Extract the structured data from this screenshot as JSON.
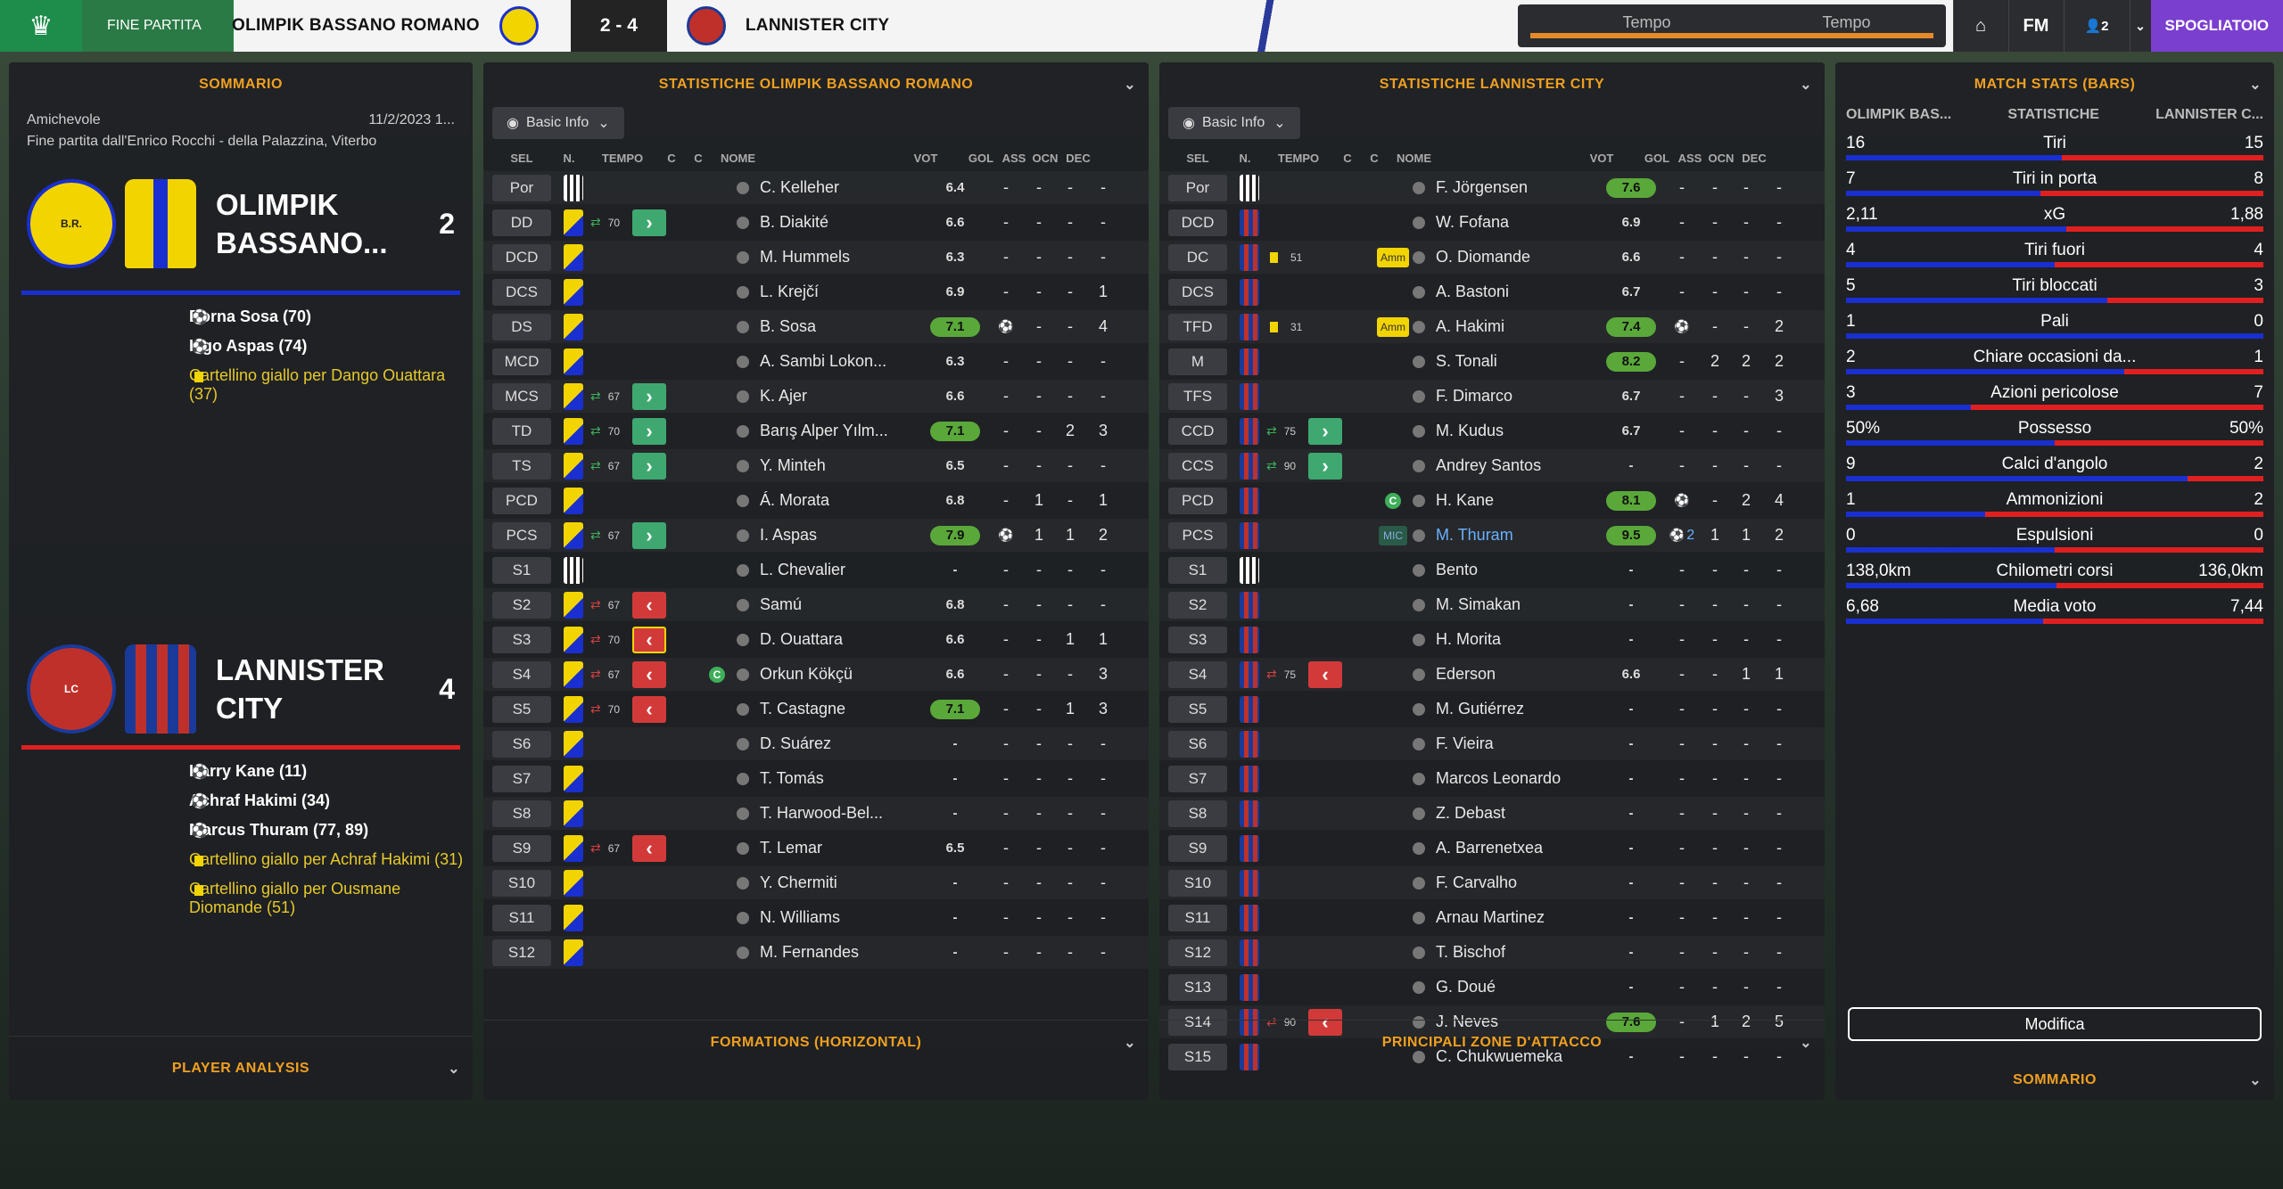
{
  "topbar": {
    "status": "FINE PARTITA",
    "home_team": "OLIMPIK BASSANO ROMANO",
    "score": "2 - 4",
    "away_team": "LANNISTER CITY",
    "time_label_1": "Tempo",
    "time_label_2": "Tempo",
    "fm": "FM",
    "people": "2",
    "spogliatoio": "SPOGLIATOIO"
  },
  "colors": {
    "home": "#1a2fd0",
    "away": "#e02020",
    "accent": "#f0a020"
  },
  "sommario": {
    "title": "SOMMARIO",
    "match_type": "Amichevole",
    "date": "11/2/2023 1...",
    "venue": "Fine partita dall'Enrico Rocchi - della Palazzina, Viterbo",
    "home_name": "OLIMPIK BASSANO...",
    "home_score": "2",
    "home_events": [
      {
        "type": "goal",
        "text": "Borna Sosa (70)"
      },
      {
        "type": "goal",
        "text": "Iago Aspas (74)"
      },
      {
        "type": "yellow",
        "text": "Cartellino giallo per Dango Ouattara (37)"
      }
    ],
    "away_name": "LANNISTER CITY",
    "away_score": "4",
    "away_events": [
      {
        "type": "goal",
        "text": "Harry Kane (11)"
      },
      {
        "type": "goal",
        "text": "Achraf Hakimi (34)"
      },
      {
        "type": "goal",
        "text": "Marcus Thuram (77, 89)"
      },
      {
        "type": "yellow",
        "text": "Cartellino giallo per Achraf Hakimi (31)"
      },
      {
        "type": "yellow",
        "text": "Cartellino giallo per Ousmane Diomande (51)"
      }
    ],
    "player_analysis": "PLAYER ANALYSIS"
  },
  "home_stats": {
    "title": "STATISTICHE OLIMPIK BASSANO ROMANO",
    "dropdown": "Basic Info",
    "headers": {
      "sel": "SEL",
      "n": "N.",
      "tempo": "TEMPO",
      "c1": "C",
      "c2": "C",
      "nome": "NOME",
      "vot": "VOT",
      "gol": "GOL",
      "ass": "ASS",
      "ocn": "OCN",
      "dec": "DEC"
    },
    "rows": [
      {
        "pos": "Por",
        "min": "",
        "sub": "",
        "c": "",
        "name": "C. Kelleher",
        "vot": "6.4",
        "g": false,
        "gol": "-",
        "ass": "-",
        "ocn": "-",
        "dec": "-",
        "goalicon": false
      },
      {
        "pos": "DD",
        "min": "70",
        "sub": "in",
        "c": "",
        "name": "B. Diakité",
        "vot": "6.6",
        "g": false,
        "gol": "-",
        "ass": "-",
        "ocn": "-",
        "dec": "-",
        "goalicon": false
      },
      {
        "pos": "DCD",
        "min": "",
        "sub": "",
        "c": "",
        "name": "M. Hummels",
        "vot": "6.3",
        "g": false,
        "gol": "-",
        "ass": "-",
        "ocn": "-",
        "dec": "-",
        "goalicon": false
      },
      {
        "pos": "DCS",
        "min": "",
        "sub": "",
        "c": "",
        "name": "L. Krejčí",
        "vot": "6.9",
        "g": false,
        "gol": "-",
        "ass": "-",
        "ocn": "-",
        "dec": "1",
        "goalicon": false
      },
      {
        "pos": "DS",
        "min": "",
        "sub": "",
        "c": "",
        "name": "B. Sosa",
        "vot": "7.1",
        "g": true,
        "gol": "",
        "ass": "-",
        "ocn": "-",
        "dec": "4",
        "goalicon": true
      },
      {
        "pos": "MCD",
        "min": "",
        "sub": "",
        "c": "",
        "name": "A. Sambi Lokon...",
        "vot": "6.3",
        "g": false,
        "gol": "-",
        "ass": "-",
        "ocn": "-",
        "dec": "-",
        "goalicon": false
      },
      {
        "pos": "MCS",
        "min": "67",
        "sub": "in",
        "c": "",
        "name": "K. Ajer",
        "vot": "6.6",
        "g": false,
        "gol": "-",
        "ass": "-",
        "ocn": "-",
        "dec": "-",
        "goalicon": false
      },
      {
        "pos": "TD",
        "min": "70",
        "sub": "in",
        "c": "",
        "name": "Barış Alper Yılm...",
        "vot": "7.1",
        "g": true,
        "gol": "-",
        "ass": "-",
        "ocn": "2",
        "dec": "3",
        "goalicon": false
      },
      {
        "pos": "TS",
        "min": "67",
        "sub": "in",
        "c": "",
        "name": "Y. Minteh",
        "vot": "6.5",
        "g": false,
        "gol": "-",
        "ass": "-",
        "ocn": "-",
        "dec": "-",
        "goalicon": false
      },
      {
        "pos": "PCD",
        "min": "",
        "sub": "",
        "c": "",
        "name": "Á. Morata",
        "vot": "6.8",
        "g": false,
        "gol": "-",
        "ass": "1",
        "ocn": "-",
        "dec": "1",
        "goalicon": false
      },
      {
        "pos": "PCS",
        "min": "67",
        "sub": "in",
        "c": "",
        "name": "I. Aspas",
        "vot": "7.9",
        "g": true,
        "gol": "",
        "ass": "1",
        "ocn": "1",
        "dec": "2",
        "goalicon": true
      },
      {
        "pos": "S1",
        "min": "",
        "sub": "",
        "c": "",
        "name": "L. Chevalier",
        "vot": "-",
        "g": false,
        "gol": "-",
        "ass": "-",
        "ocn": "-",
        "dec": "-",
        "goalicon": false
      },
      {
        "pos": "S2",
        "min": "67",
        "sub": "out",
        "c": "",
        "name": "Samú",
        "vot": "6.8",
        "g": false,
        "gol": "-",
        "ass": "-",
        "ocn": "-",
        "dec": "-",
        "goalicon": false
      },
      {
        "pos": "S3",
        "min": "70",
        "sub": "outy",
        "c": "",
        "name": "D. Ouattara",
        "vot": "6.6",
        "g": false,
        "gol": "-",
        "ass": "-",
        "ocn": "1",
        "dec": "1",
        "goalicon": false
      },
      {
        "pos": "S4",
        "min": "67",
        "sub": "out",
        "c": "C",
        "name": "Orkun Kökçü",
        "vot": "6.6",
        "g": false,
        "gol": "-",
        "ass": "-",
        "ocn": "-",
        "dec": "3",
        "goalicon": false
      },
      {
        "pos": "S5",
        "min": "70",
        "sub": "out",
        "c": "",
        "name": "T. Castagne",
        "vot": "7.1",
        "g": true,
        "gol": "-",
        "ass": "-",
        "ocn": "1",
        "dec": "3",
        "goalicon": false
      },
      {
        "pos": "S6",
        "min": "",
        "sub": "",
        "c": "",
        "name": "D. Suárez",
        "vot": "-",
        "g": false,
        "gol": "-",
        "ass": "-",
        "ocn": "-",
        "dec": "-",
        "goalicon": false
      },
      {
        "pos": "S7",
        "min": "",
        "sub": "",
        "c": "",
        "name": "T. Tomás",
        "vot": "-",
        "g": false,
        "gol": "-",
        "ass": "-",
        "ocn": "-",
        "dec": "-",
        "goalicon": false
      },
      {
        "pos": "S8",
        "min": "",
        "sub": "",
        "c": "",
        "name": "T. Harwood-Bel...",
        "vot": "-",
        "g": false,
        "gol": "-",
        "ass": "-",
        "ocn": "-",
        "dec": "-",
        "goalicon": false
      },
      {
        "pos": "S9",
        "min": "67",
        "sub": "out",
        "c": "",
        "name": "T. Lemar",
        "vot": "6.5",
        "g": false,
        "gol": "-",
        "ass": "-",
        "ocn": "-",
        "dec": "-",
        "goalicon": false
      },
      {
        "pos": "S10",
        "min": "",
        "sub": "",
        "c": "",
        "name": "Y. Chermiti",
        "vot": "-",
        "g": false,
        "gol": "-",
        "ass": "-",
        "ocn": "-",
        "dec": "-",
        "goalicon": false
      },
      {
        "pos": "S11",
        "min": "",
        "sub": "",
        "c": "",
        "name": "N. Williams",
        "vot": "-",
        "g": false,
        "gol": "-",
        "ass": "-",
        "ocn": "-",
        "dec": "-",
        "goalicon": false
      },
      {
        "pos": "S12",
        "min": "",
        "sub": "",
        "c": "",
        "name": "M. Fernandes",
        "vot": "-",
        "g": false,
        "gol": "-",
        "ass": "-",
        "ocn": "-",
        "dec": "-",
        "goalicon": false
      }
    ],
    "formations": "FORMATIONS (HORIZONTAL)"
  },
  "away_stats": {
    "title": "STATISTICHE LANNISTER CITY",
    "dropdown": "Basic Info",
    "headers": {
      "sel": "SEL",
      "n": "N.",
      "tempo": "TEMPO",
      "c1": "C",
      "c2": "C",
      "nome": "NOME",
      "vot": "VOT",
      "gol": "GOL",
      "ass": "ASS",
      "ocn": "OCN",
      "dec": "DEC"
    },
    "rows": [
      {
        "pos": "Por",
        "min": "",
        "sub": "",
        "c": "",
        "name": "F. Jörgensen",
        "vot": "7.6",
        "g": true,
        "gol": "-",
        "ass": "-",
        "ocn": "-",
        "dec": "-",
        "goalicon": false
      },
      {
        "pos": "DCD",
        "min": "",
        "sub": "",
        "c": "",
        "name": "W. Fofana",
        "vot": "6.9",
        "g": false,
        "gol": "-",
        "ass": "-",
        "ocn": "-",
        "dec": "-",
        "goalicon": false
      },
      {
        "pos": "DC",
        "min": "51",
        "sub": "",
        "c": "Amm",
        "name": "O. Diomande",
        "vot": "6.6",
        "g": false,
        "gol": "-",
        "ass": "-",
        "ocn": "-",
        "dec": "-",
        "goalicon": false
      },
      {
        "pos": "DCS",
        "min": "",
        "sub": "",
        "c": "",
        "name": "A. Bastoni",
        "vot": "6.7",
        "g": false,
        "gol": "-",
        "ass": "-",
        "ocn": "-",
        "dec": "-",
        "goalicon": false
      },
      {
        "pos": "TFD",
        "min": "31",
        "sub": "",
        "c": "Amm",
        "name": "A. Hakimi",
        "vot": "7.4",
        "g": true,
        "gol": "",
        "ass": "-",
        "ocn": "-",
        "dec": "2",
        "goalicon": true
      },
      {
        "pos": "M",
        "min": "",
        "sub": "",
        "c": "",
        "name": "S. Tonali",
        "vot": "8.2",
        "g": true,
        "gol": "-",
        "ass": "2",
        "ocn": "2",
        "dec": "2",
        "goalicon": false
      },
      {
        "pos": "TFS",
        "min": "",
        "sub": "",
        "c": "",
        "name": "F. Dimarco",
        "vot": "6.7",
        "g": false,
        "gol": "-",
        "ass": "-",
        "ocn": "-",
        "dec": "3",
        "goalicon": false
      },
      {
        "pos": "CCD",
        "min": "75",
        "sub": "in",
        "c": "",
        "name": "M. Kudus",
        "vot": "6.7",
        "g": false,
        "gol": "-",
        "ass": "-",
        "ocn": "-",
        "dec": "-",
        "goalicon": false
      },
      {
        "pos": "CCS",
        "min": "90",
        "sub": "in",
        "c": "",
        "name": "Andrey Santos",
        "vot": "-",
        "g": false,
        "gol": "-",
        "ass": "-",
        "ocn": "-",
        "dec": "-",
        "goalicon": false
      },
      {
        "pos": "PCD",
        "min": "",
        "sub": "",
        "c": "C",
        "name": "H. Kane",
        "vot": "8.1",
        "g": true,
        "gol": "",
        "ass": "-",
        "ocn": "2",
        "dec": "4",
        "goalicon": true
      },
      {
        "pos": "PCS",
        "min": "",
        "sub": "",
        "c": "MIC",
        "name": "M. Thuram",
        "vot": "9.5",
        "g": true,
        "gol": "2",
        "ass": "1",
        "ocn": "1",
        "dec": "2",
        "goalicon": true
      },
      {
        "pos": "S1",
        "min": "",
        "sub": "",
        "c": "",
        "name": "Bento",
        "vot": "-",
        "g": false,
        "gol": "-",
        "ass": "-",
        "ocn": "-",
        "dec": "-",
        "goalicon": false
      },
      {
        "pos": "S2",
        "min": "",
        "sub": "",
        "c": "",
        "name": "M. Simakan",
        "vot": "-",
        "g": false,
        "gol": "-",
        "ass": "-",
        "ocn": "-",
        "dec": "-",
        "goalicon": false
      },
      {
        "pos": "S3",
        "min": "",
        "sub": "",
        "c": "",
        "name": "H. Morita",
        "vot": "-",
        "g": false,
        "gol": "-",
        "ass": "-",
        "ocn": "-",
        "dec": "-",
        "goalicon": false
      },
      {
        "pos": "S4",
        "min": "75",
        "sub": "out",
        "c": "",
        "name": "Ederson",
        "vot": "6.6",
        "g": false,
        "gol": "-",
        "ass": "-",
        "ocn": "1",
        "dec": "1",
        "goalicon": false
      },
      {
        "pos": "S5",
        "min": "",
        "sub": "",
        "c": "",
        "name": "M. Gutiérrez",
        "vot": "-",
        "g": false,
        "gol": "-",
        "ass": "-",
        "ocn": "-",
        "dec": "-",
        "goalicon": false
      },
      {
        "pos": "S6",
        "min": "",
        "sub": "",
        "c": "",
        "name": "F. Vieira",
        "vot": "-",
        "g": false,
        "gol": "-",
        "ass": "-",
        "ocn": "-",
        "dec": "-",
        "goalicon": false
      },
      {
        "pos": "S7",
        "min": "",
        "sub": "",
        "c": "",
        "name": "Marcos Leonardo",
        "vot": "-",
        "g": false,
        "gol": "-",
        "ass": "-",
        "ocn": "-",
        "dec": "-",
        "goalicon": false
      },
      {
        "pos": "S8",
        "min": "",
        "sub": "",
        "c": "",
        "name": "Z. Debast",
        "vot": "-",
        "g": false,
        "gol": "-",
        "ass": "-",
        "ocn": "-",
        "dec": "-",
        "goalicon": false
      },
      {
        "pos": "S9",
        "min": "",
        "sub": "",
        "c": "",
        "name": "A. Barrenetxea",
        "vot": "-",
        "g": false,
        "gol": "-",
        "ass": "-",
        "ocn": "-",
        "dec": "-",
        "goalicon": false
      },
      {
        "pos": "S10",
        "min": "",
        "sub": "",
        "c": "",
        "name": "F. Carvalho",
        "vot": "-",
        "g": false,
        "gol": "-",
        "ass": "-",
        "ocn": "-",
        "dec": "-",
        "goalicon": false
      },
      {
        "pos": "S11",
        "min": "",
        "sub": "",
        "c": "",
        "name": "Arnau Martinez",
        "vot": "-",
        "g": false,
        "gol": "-",
        "ass": "-",
        "ocn": "-",
        "dec": "-",
        "goalicon": false
      },
      {
        "pos": "S12",
        "min": "",
        "sub": "",
        "c": "",
        "name": "T. Bischof",
        "vot": "-",
        "g": false,
        "gol": "-",
        "ass": "-",
        "ocn": "-",
        "dec": "-",
        "goalicon": false
      },
      {
        "pos": "S13",
        "min": "",
        "sub": "",
        "c": "",
        "name": "G. Doué",
        "vot": "-",
        "g": false,
        "gol": "-",
        "ass": "-",
        "ocn": "-",
        "dec": "-",
        "goalicon": false
      },
      {
        "pos": "S14",
        "min": "90",
        "sub": "out",
        "c": "",
        "name": "J. Neves",
        "vot": "7.6",
        "g": true,
        "gol": "-",
        "ass": "1",
        "ocn": "2",
        "dec": "5",
        "goalicon": false
      },
      {
        "pos": "S15",
        "min": "",
        "sub": "",
        "c": "",
        "name": "C. Chukwuemeka",
        "vot": "-",
        "g": false,
        "gol": "-",
        "ass": "-",
        "ocn": "-",
        "dec": "-",
        "goalicon": false
      }
    ],
    "attack_zones": "PRINCIPALI ZONE D'ATTACCO"
  },
  "match_stats": {
    "title": "MATCH STATS (BARS)",
    "col_home": "OLIMPIK BAS...",
    "col_mid": "STATISTICHE",
    "col_away": "LANNISTER C...",
    "rows": [
      {
        "label": "Tiri",
        "home": "16",
        "away": "15",
        "h": 16,
        "a": 15
      },
      {
        "label": "Tiri in porta",
        "home": "7",
        "away": "8",
        "h": 7,
        "a": 8
      },
      {
        "label": "xG",
        "home": "2,11",
        "away": "1,88",
        "h": 2.11,
        "a": 1.88
      },
      {
        "label": "Tiri fuori",
        "home": "4",
        "away": "4",
        "h": 4,
        "a": 4
      },
      {
        "label": "Tiri bloccati",
        "home": "5",
        "away": "3",
        "h": 5,
        "a": 3
      },
      {
        "label": "Pali",
        "home": "1",
        "away": "0",
        "h": 1,
        "a": 0
      },
      {
        "label": "Chiare occasioni da...",
        "home": "2",
        "away": "1",
        "h": 2,
        "a": 1
      },
      {
        "label": "Azioni pericolose",
        "home": "3",
        "away": "7",
        "h": 3,
        "a": 7
      },
      {
        "label": "Possesso",
        "home": "50%",
        "away": "50%",
        "h": 50,
        "a": 50
      },
      {
        "label": "Calci d'angolo",
        "home": "9",
        "away": "2",
        "h": 9,
        "a": 2
      },
      {
        "label": "Ammonizioni",
        "home": "1",
        "away": "2",
        "h": 1,
        "a": 2
      },
      {
        "label": "Espulsioni",
        "home": "0",
        "away": "0",
        "h": 0,
        "a": 0
      },
      {
        "label": "Chilometri corsi",
        "home": "138,0km",
        "away": "136,0km",
        "h": 138,
        "a": 136
      },
      {
        "label": "Media voto",
        "home": "6,68",
        "away": "7,44",
        "h": 6.68,
        "a": 7.44
      }
    ],
    "modifica": "Modifica",
    "sommario_title": "SOMMARIO",
    "match_type": "Amichevole",
    "date": "11/2/2023 1...",
    "venue": "Fine partita dall'Enrico Rocchi - della Palazzina,"
  }
}
